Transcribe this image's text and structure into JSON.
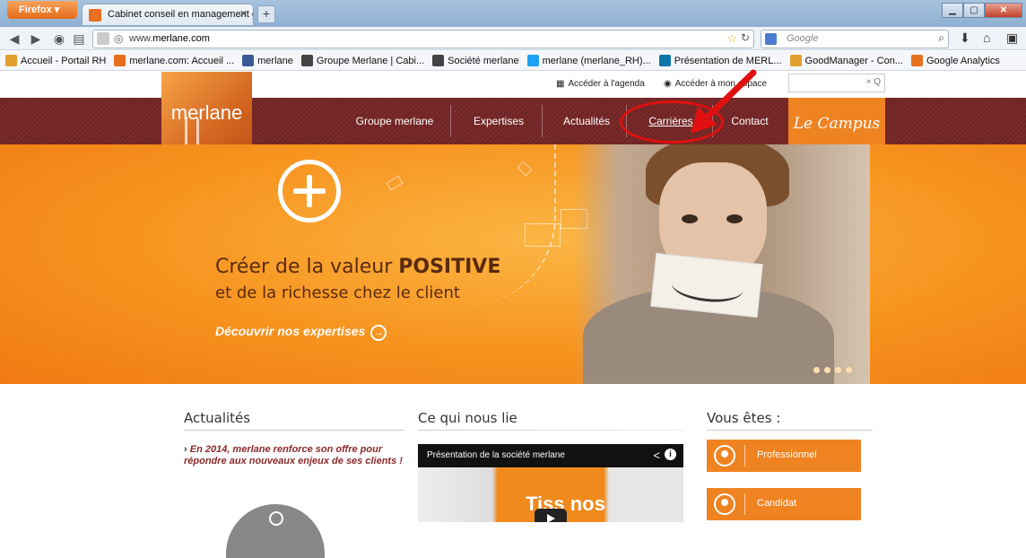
{
  "browser": {
    "menu_label": "Firefox ▾",
    "tab_title": "Cabinet conseil en management grh res...",
    "url_prefix": "www.",
    "url_host": "merlane.com",
    "search_placeholder": "Google",
    "bookmarks": [
      {
        "label": "Accueil - Portail RH",
        "color": "#e0a030"
      },
      {
        "label": "merlane.com: Accueil ...",
        "color": "#e86d1f"
      },
      {
        "label": "merlane",
        "color": "#3b5998"
      },
      {
        "label": "Groupe Merlane | Cabi...",
        "color": "#444444"
      },
      {
        "label": "Société merlane",
        "color": "#444444"
      },
      {
        "label": "merlane (merlane_RH)...",
        "color": "#1da1f2"
      },
      {
        "label": "Présentation de MERL...",
        "color": "#0e76a8"
      },
      {
        "label": "GoodManager - Con...",
        "color": "#e0a030"
      },
      {
        "label": "Google Analytics",
        "color": "#e8711e"
      }
    ]
  },
  "site": {
    "logo_text": "merlane",
    "utility": {
      "agenda": "Accéder à l'agenda",
      "space": "Accéder à mon espace",
      "search_clear": "× Q"
    },
    "nav": {
      "groupe": "Groupe merlane",
      "expertises": "Expertises",
      "actualites": "Actualités",
      "carrieres": "Carrières",
      "contact": "Contact"
    },
    "campus": "Le Campus",
    "hero": {
      "line1_pre": "Créer de la valeur ",
      "line1_bold": "POSITIVE",
      "line2": "et de la richesse chez le client",
      "cta": "Découvrir nos expertises",
      "cta_icon": "→"
    },
    "sections": {
      "news_title": "Actualités",
      "news_item": "En 2014, merlane renforce son offre pour répondre aux nouveaux enjeux de ses clients !",
      "links_title": "Ce qui nous lie",
      "video_title": "Présentation de la société merlane",
      "video_thumb_text": "Tiss    nos",
      "you_title": "Vous êtes :",
      "you_items": [
        "Professionnel",
        "Candidat"
      ]
    }
  }
}
